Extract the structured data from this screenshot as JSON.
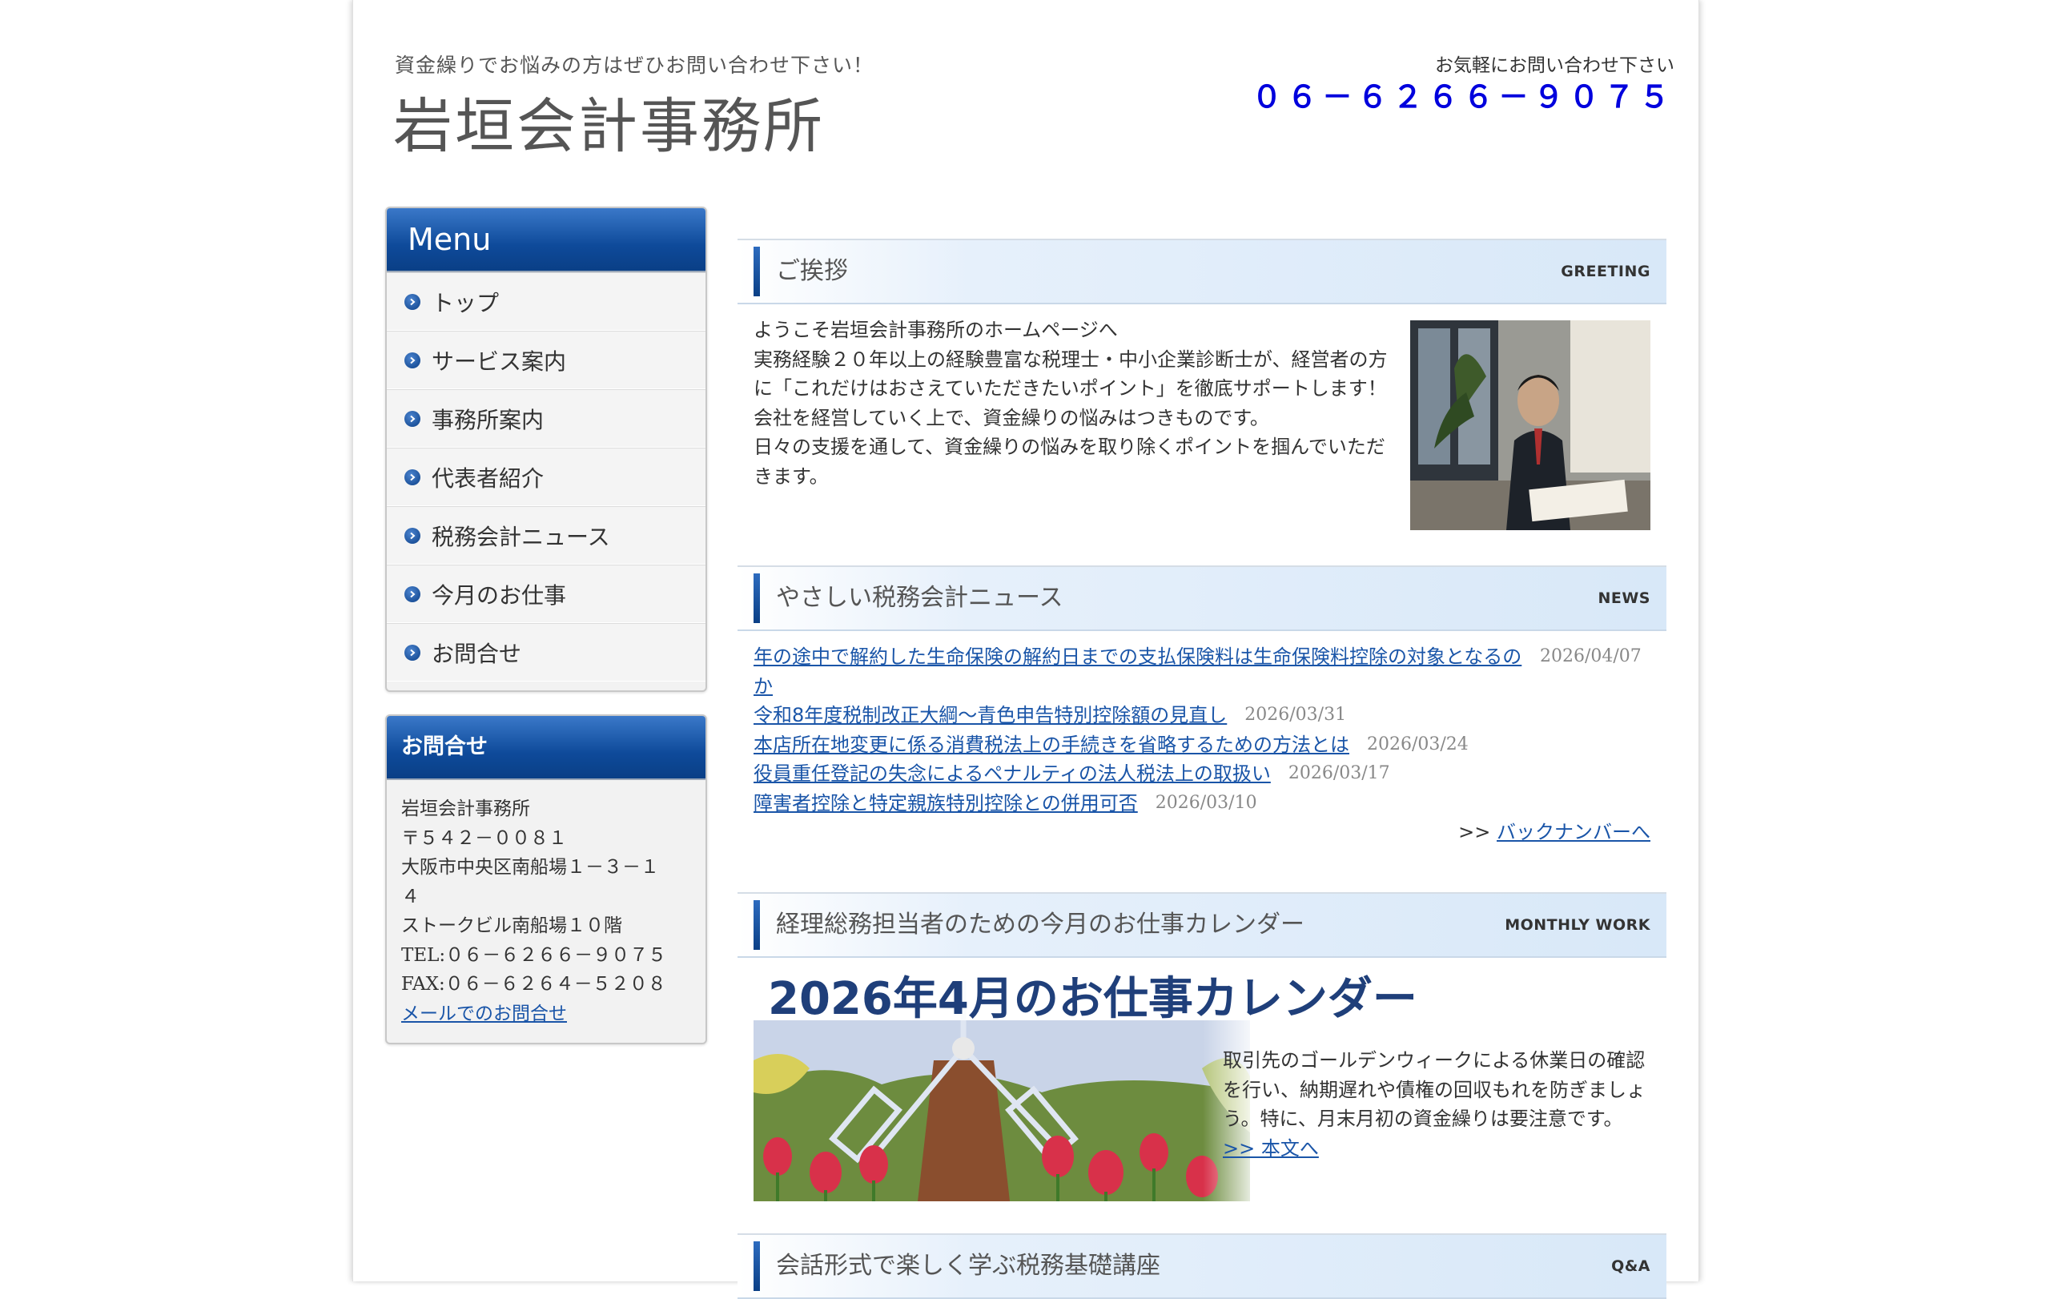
{
  "header": {
    "tagline": "資金繰りでお悩みの方はぜひお問い合わせ下さい！",
    "title": "岩垣会計事務所",
    "contact_lead": "お気軽にお問い合わせ下さい",
    "phone": "０６－６２６６－９０７５"
  },
  "sidebar": {
    "menu_heading": "Menu",
    "items": [
      {
        "label": "トップ"
      },
      {
        "label": "サービス案内"
      },
      {
        "label": "事務所案内"
      },
      {
        "label": "代表者紹介"
      },
      {
        "label": "税務会計ニュース"
      },
      {
        "label": "今月のお仕事"
      },
      {
        "label": "お問合せ"
      }
    ],
    "contact_heading": "お問合せ",
    "contact": {
      "name": "岩垣会計事務所",
      "postal": "〒５４２－００８１",
      "address1": "大阪市中央区南船場１－３－１",
      "address2": "４",
      "building": "ストークビル南船場１０階",
      "tel": "TEL:０６－６２６６－９０７５",
      "fax": "FAX:０６－６２６４－５２０８",
      "mail_link": "メールでのお問合せ"
    }
  },
  "greeting": {
    "title": "ご挨拶",
    "tag": "GREETING",
    "lines": [
      "ようこそ岩垣会計事務所のホームページへ",
      "実務経験２０年以上の経験豊富な税理士・中小企業診断士が、経営者の方に「これだけはおさえていただきたいポイント」を徹底サポートします！",
      "会社を経営していく上で、資金繰りの悩みはつきものです。",
      "日々の支援を通して、資金繰りの悩みを取り除くポイントを掴んでいただきます。"
    ]
  },
  "news": {
    "title": "やさしい税務会計ニュース",
    "tag": "NEWS",
    "items": [
      {
        "title": "年の途中で解約した生命保険の解約日までの支払保険料は生命保険料控除の対象となるのか",
        "date": "2026/04/07"
      },
      {
        "title": "令和8年度税制改正大綱～青色申告特別控除額の見直し",
        "date": "2026/03/31"
      },
      {
        "title": "本店所在地変更に係る消費税法上の手続きを省略するための方法とは",
        "date": "2026/03/24"
      },
      {
        "title": "役員重任登記の失念によるペナルティの法人税法上の取扱い",
        "date": "2026/03/17"
      },
      {
        "title": "障害者控除と特定親族特別控除との併用可否",
        "date": "2026/03/10"
      }
    ],
    "back_prefix": ">> ",
    "back_link": "バックナンバーへ"
  },
  "monthly": {
    "title": "経理総務担当者のための今月のお仕事カレンダー",
    "tag": "MONTHLY WORK",
    "banner_title": "2026年4月のお仕事カレンダー",
    "text": "取引先のゴールデンウィークによる休業日の確認を行い、納期遅れや債権の回収もれを防ぎましょう。特に、月末月初の資金繰りは要注意です。",
    "more_link": ">> 本文へ"
  },
  "qa": {
    "title": "会話形式で楽しく学ぶ税務基礎講座",
    "tag": "Q&A"
  }
}
